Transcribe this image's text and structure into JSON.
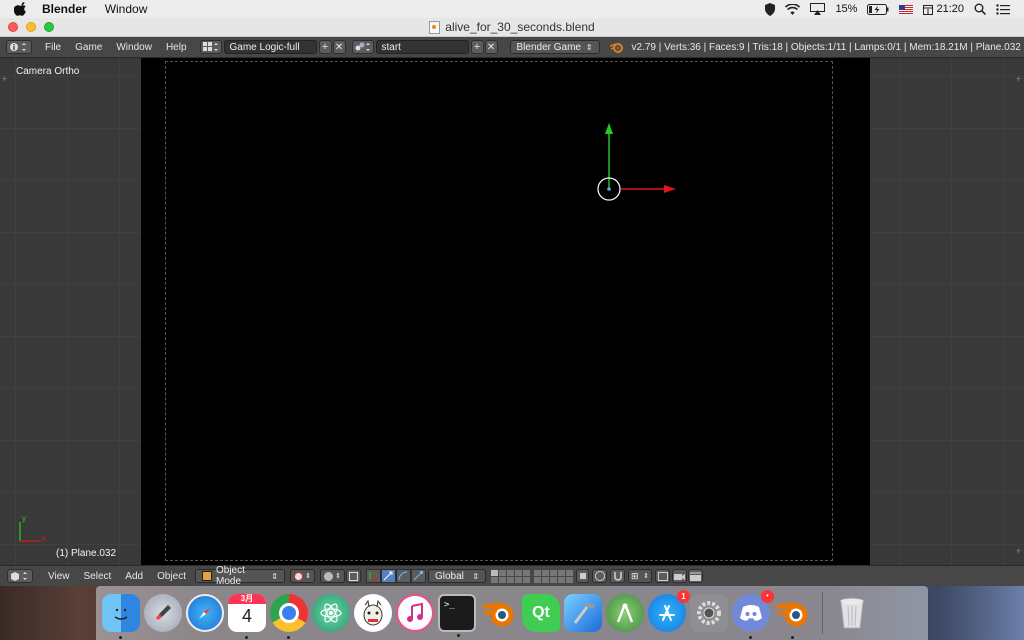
{
  "menubar": {
    "app_name": "Blender",
    "items": [
      "Window"
    ],
    "battery": "15%",
    "time": "21:20"
  },
  "window": {
    "title": "alive_for_30_seconds.blend"
  },
  "info_header": {
    "menus": [
      "File",
      "Game",
      "Window",
      "Help"
    ],
    "screen_layout": "Game Logic-full",
    "scene": "start",
    "engine": "Blender Game",
    "stats": "v2.79 | Verts:36 | Faces:9 | Tris:18 | Objects:1/11 | Lamps:0/1 | Mem:18.21M | Plane.032"
  },
  "viewport": {
    "view_name": "Camera Ortho",
    "object_label": "(1) Plane.032",
    "axis_x": "x",
    "axis_y": "y"
  },
  "view3d_header": {
    "menus": [
      "View",
      "Select",
      "Add",
      "Object"
    ],
    "mode": "Object Mode",
    "orientation": "Global"
  },
  "dock": {
    "calendar_month": "3月",
    "calendar_day": "4",
    "appstore_badge": "1",
    "apps": [
      "Finder",
      "Launchpad",
      "Safari",
      "Calendar",
      "Chrome",
      "Atom",
      "Alpaca",
      "iTunes",
      "Terminal",
      "Blender",
      "Qt Creator",
      "Xcode",
      "Android Studio",
      "App Store",
      "System Preferences",
      "Discord",
      "Blender",
      "Trash"
    ]
  },
  "colors": {
    "axis_x": "#e01515",
    "axis_y": "#1fd11f",
    "accent": "#5680c2"
  }
}
